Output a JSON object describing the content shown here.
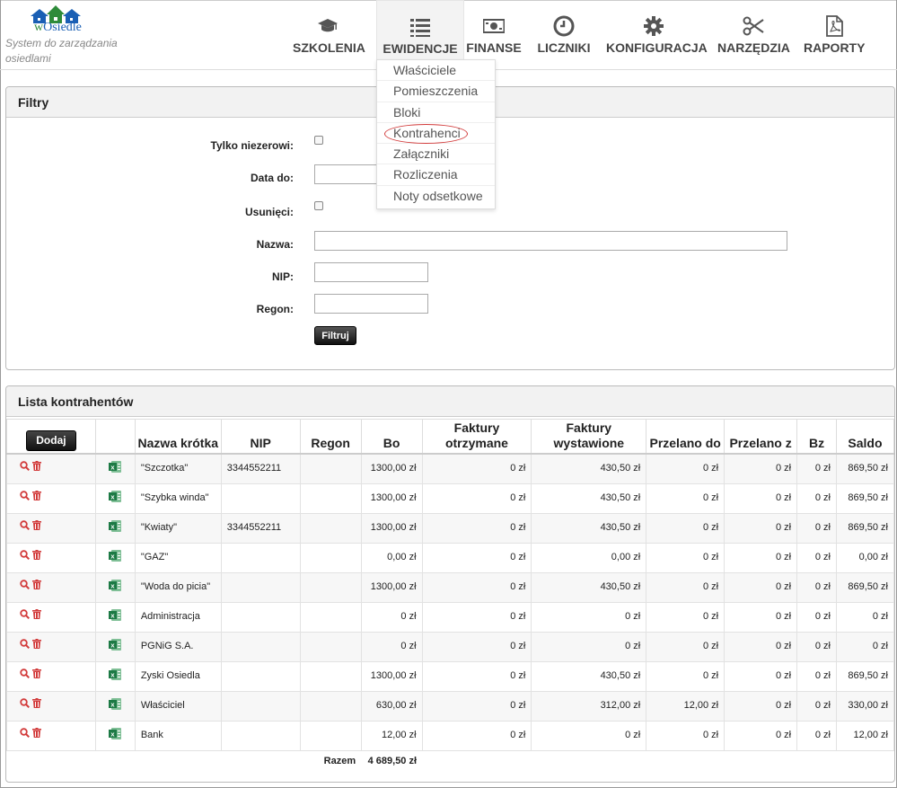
{
  "app": {
    "name": "wOsiedle",
    "tagline": "System do zarządzania osiedlami"
  },
  "nav": [
    {
      "label": "SZKOLENIA",
      "icon": "graduation-cap-icon"
    },
    {
      "label": "EWIDENCJE",
      "icon": "list-icon"
    },
    {
      "label": "FINANSE",
      "icon": "money-icon"
    },
    {
      "label": "LICZNIKI",
      "icon": "clock-icon"
    },
    {
      "label": "KONFIGURACJA",
      "icon": "gear-icon"
    },
    {
      "label": "NARZĘDZIA",
      "icon": "scissors-icon"
    },
    {
      "label": "RAPORTY",
      "icon": "pdf-file-icon"
    }
  ],
  "dropdown": [
    "Właściciele",
    "Pomieszczenia",
    "Bloki",
    "Kontrahenci",
    "Załączniki",
    "Rozliczenia",
    "Noty odsetkowe"
  ],
  "filters": {
    "title": "Filtry",
    "only_not_zero_label": "Tylko niezerowi:",
    "date_to_label": "Data do:",
    "deleted_label": "Usunięci:",
    "name_label": "Nazwa:",
    "nip_label": "NIP:",
    "regon_label": "Regon:",
    "filter_button": "Filtruj",
    "date_to_value": "",
    "name_value": "",
    "nip_value": "",
    "regon_value": ""
  },
  "list": {
    "title": "Lista kontrahentów",
    "add_button": "Dodaj",
    "columns": {
      "short_name": "Nazwa krótka",
      "nip": "NIP",
      "regon": "Regon",
      "bo": "Bo",
      "invoices_received": "Faktury otrzymane",
      "invoices_issued": "Faktury wystawione",
      "transferred_to": "Przelano do",
      "transferred_from": "Przelano z",
      "bz": "Bz",
      "balance": "Saldo"
    },
    "rows": [
      {
        "name": "\"Szczotka\"",
        "nip": "3344552211",
        "regon": "",
        "bo": "1300,00 zł",
        "recv": "0 zł",
        "issued": "430,50 zł",
        "to": "0 zł",
        "from": "0 zł",
        "bz": "0 zł",
        "saldo": "869,50 zł"
      },
      {
        "name": "\"Szybka winda\"",
        "nip": "",
        "regon": "",
        "bo": "1300,00 zł",
        "recv": "0 zł",
        "issued": "430,50 zł",
        "to": "0 zł",
        "from": "0 zł",
        "bz": "0 zł",
        "saldo": "869,50 zł"
      },
      {
        "name": "\"Kwiaty\"",
        "nip": "3344552211",
        "regon": "",
        "bo": "1300,00 zł",
        "recv": "0 zł",
        "issued": "430,50 zł",
        "to": "0 zł",
        "from": "0 zł",
        "bz": "0 zł",
        "saldo": "869,50 zł"
      },
      {
        "name": "\"GAZ\"",
        "nip": "",
        "regon": "",
        "bo": "0,00 zł",
        "recv": "0 zł",
        "issued": "0,00 zł",
        "to": "0 zł",
        "from": "0 zł",
        "bz": "0 zł",
        "saldo": "0,00 zł"
      },
      {
        "name": "\"Woda do picia\"",
        "nip": "",
        "regon": "",
        "bo": "1300,00 zł",
        "recv": "0 zł",
        "issued": "430,50 zł",
        "to": "0 zł",
        "from": "0 zł",
        "bz": "0 zł",
        "saldo": "869,50 zł"
      },
      {
        "name": "Administracja",
        "nip": "",
        "regon": "",
        "bo": "0 zł",
        "recv": "0 zł",
        "issued": "0 zł",
        "to": "0 zł",
        "from": "0 zł",
        "bz": "0 zł",
        "saldo": "0 zł"
      },
      {
        "name": "PGNiG S.A.",
        "nip": "",
        "regon": "",
        "bo": "0 zł",
        "recv": "0 zł",
        "issued": "0 zł",
        "to": "0 zł",
        "from": "0 zł",
        "bz": "0 zł",
        "saldo": "0 zł"
      },
      {
        "name": "Zyski Osiedla",
        "nip": "",
        "regon": "",
        "bo": "1300,00 zł",
        "recv": "0 zł",
        "issued": "430,50 zł",
        "to": "0 zł",
        "from": "0 zł",
        "bz": "0 zł",
        "saldo": "869,50 zł"
      },
      {
        "name": "Właściciel",
        "nip": "",
        "regon": "",
        "bo": "630,00 zł",
        "recv": "0 zł",
        "issued": "312,00 zł",
        "to": "12,00 zł",
        "from": "0 zł",
        "bz": "0 zł",
        "saldo": "330,00 zł"
      },
      {
        "name": "Bank",
        "nip": "",
        "regon": "",
        "bo": "12,00 zł",
        "recv": "0 zł",
        "issued": "0 zł",
        "to": "0 zł",
        "from": "0 zł",
        "bz": "0 zł",
        "saldo": "12,00 zł"
      }
    ],
    "total_label": "Razem",
    "total_value": "4 689,50 zł"
  },
  "colors": {
    "accent_red": "#d23b3b",
    "excel_green": "#1d7a45",
    "logo_blue": "#1a5fb4",
    "logo_green": "#2e8b3a"
  }
}
